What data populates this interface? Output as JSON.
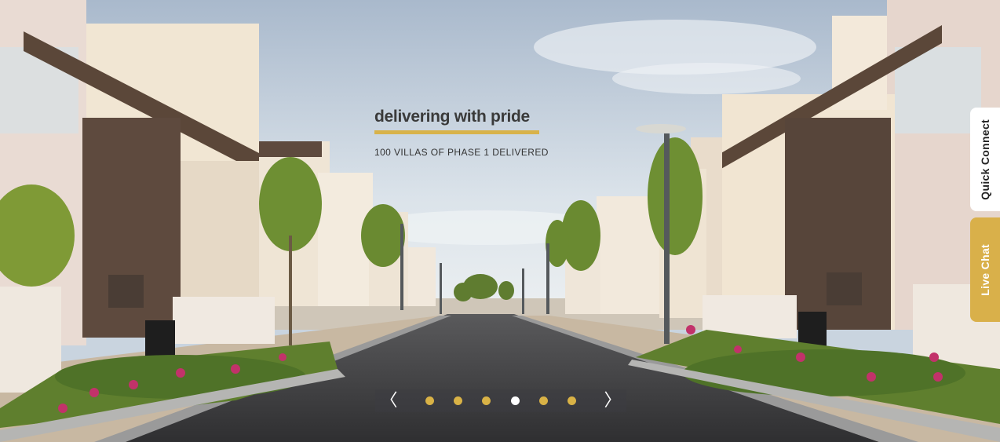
{
  "hero": {
    "title": "delivering with pride",
    "subtitle": "100 VILLAS OF PHASE 1 DELIVERED"
  },
  "slider": {
    "prev_label": "〈",
    "next_label": "〉",
    "slide_count": 6,
    "active_index": 3
  },
  "side_tabs": {
    "quick_connect": "Quick Connect",
    "live_chat": "Live Chat"
  },
  "colors": {
    "accent": "#d9b246",
    "dot_active": "#ffffff",
    "nav_bg": "rgba(60,60,65,0.55)"
  }
}
